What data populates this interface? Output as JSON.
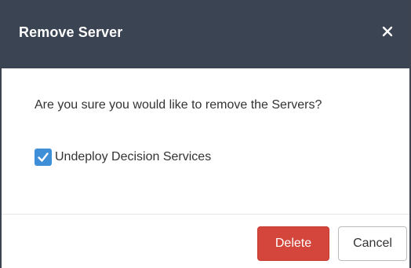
{
  "dialog": {
    "title": "Remove Server",
    "close_icon": "close-icon",
    "message": "Are you sure you would like to remove the Servers?",
    "checkbox": {
      "label": "Undeploy Decision Services",
      "checked": true
    },
    "buttons": {
      "delete_label": "Delete",
      "cancel_label": "Cancel"
    }
  },
  "colors": {
    "header_bg": "#3b4452",
    "delete_bg": "#d4463b",
    "checkbox_bg": "#3e8fd8"
  }
}
